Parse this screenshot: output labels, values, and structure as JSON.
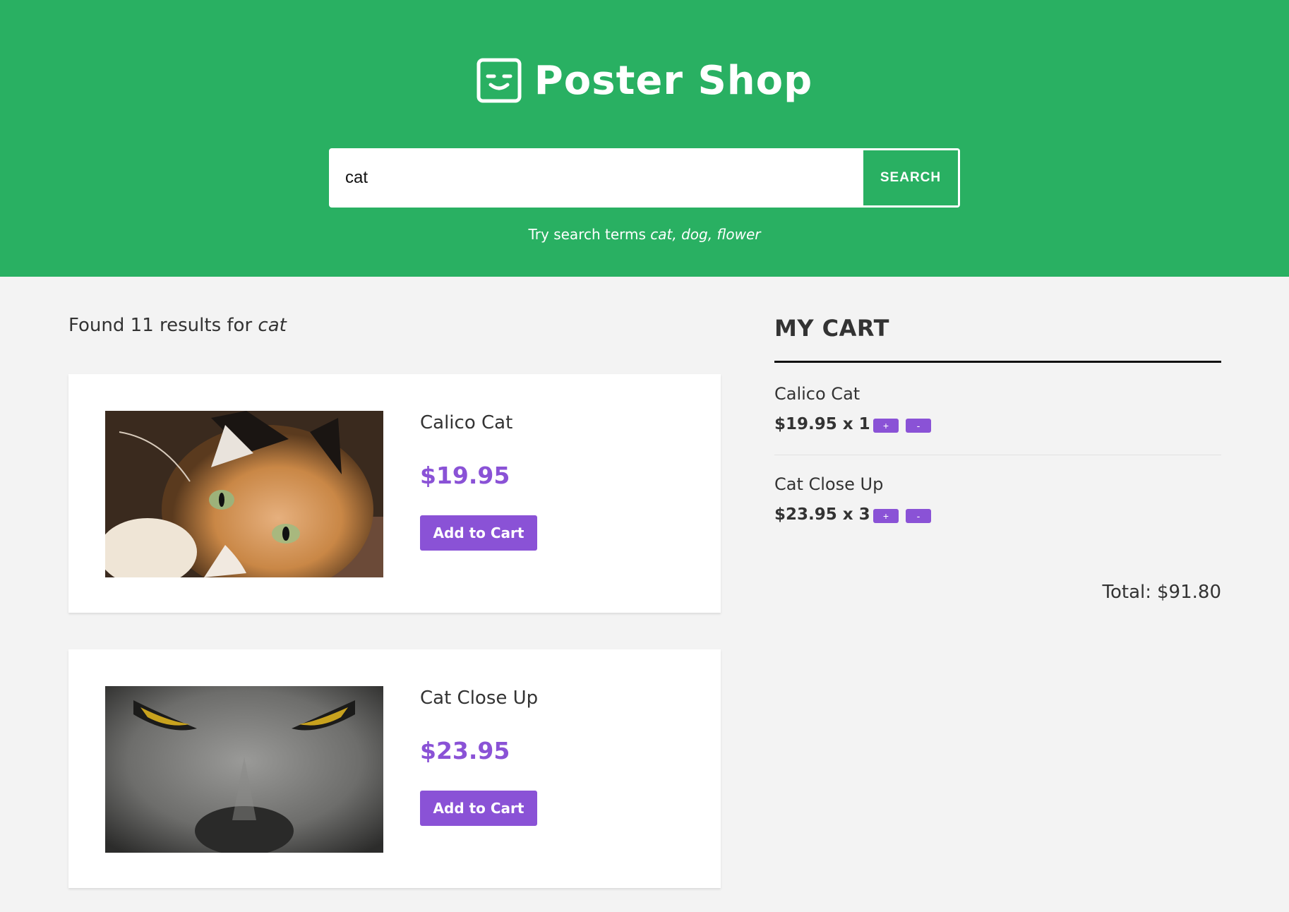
{
  "header": {
    "brand": "Poster Shop",
    "search": {
      "value": "cat",
      "button_label": "SEARCH"
    },
    "hint": {
      "prefix": "Try search terms",
      "terms": "cat, dog, flower"
    }
  },
  "results": {
    "summary_prefix": "Found 11 results for",
    "term": "cat",
    "items": [
      {
        "name": "Calico Cat",
        "price": "$19.95",
        "button_label": "Add to Cart"
      },
      {
        "name": "Cat Close Up",
        "price": "$23.95",
        "button_label": "Add to Cart"
      }
    ]
  },
  "cart": {
    "heading": "MY CART",
    "items": [
      {
        "name": "Calico Cat",
        "line": "$19.95 x 1",
        "plus_label": "+",
        "minus_label": "-"
      },
      {
        "name": "Cat Close Up",
        "line": "$23.95 x 3",
        "plus_label": "+",
        "minus_label": "-"
      }
    ],
    "total_label": "Total:",
    "total_value": "$91.80"
  },
  "colors": {
    "header_bg": "#29b062",
    "accent": "#8a52d6",
    "page_bg": "#f3f3f3"
  }
}
